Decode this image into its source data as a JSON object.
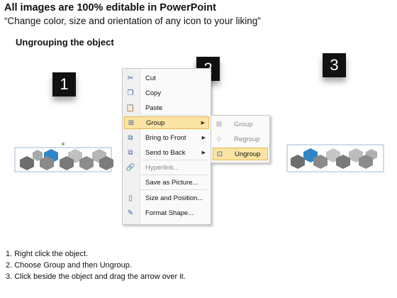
{
  "header": {
    "title": "All images are 100% editable in PowerPoint",
    "subtitle": "“Change color, size and orientation of any icon to your liking”",
    "section_heading": "Ungrouping the object"
  },
  "steps_markers": [
    "1",
    "2",
    "3"
  ],
  "context_menu": {
    "items": [
      {
        "label": "Cut",
        "icon": "scissors-icon"
      },
      {
        "label": "Copy",
        "icon": "copy-icon"
      },
      {
        "label": "Paste",
        "icon": "paste-icon"
      },
      {
        "label": "Group",
        "icon": "group-icon",
        "highlighted": true,
        "submenu": true
      },
      {
        "label": "Bring to Front",
        "icon": "bring-to-front-icon",
        "submenu": true
      },
      {
        "label": "Send to Back",
        "icon": "send-to-back-icon",
        "submenu": true
      },
      {
        "label": "Hyperlink...",
        "icon": "hyperlink-icon",
        "disabled": true
      },
      {
        "label": "Save as Picture...",
        "icon": ""
      },
      {
        "label": "Size and Position...",
        "icon": "size-position-icon"
      },
      {
        "label": "Format Shape...",
        "icon": "format-shape-icon"
      }
    ]
  },
  "group_submenu": {
    "items": [
      {
        "label": "Group",
        "icon": "group-icon",
        "disabled": true
      },
      {
        "label": "Regroup",
        "icon": "regroup-icon",
        "disabled": true
      },
      {
        "label": "Ungroup",
        "icon": "ungroup-icon",
        "highlighted": true
      }
    ]
  },
  "instructions": [
    "1.  Right click the object.",
    "2.  Choose Group and then Ungroup.",
    "3.  Click beside the object and drag the arrow over it."
  ],
  "colors": {
    "hex_gray": "#9a9a9a",
    "hex_dark": "#6e6e6e",
    "hex_light": "#c7c7c7",
    "hex_blue": "#2e86c9",
    "menu_highlight": "#fbe4a3"
  }
}
